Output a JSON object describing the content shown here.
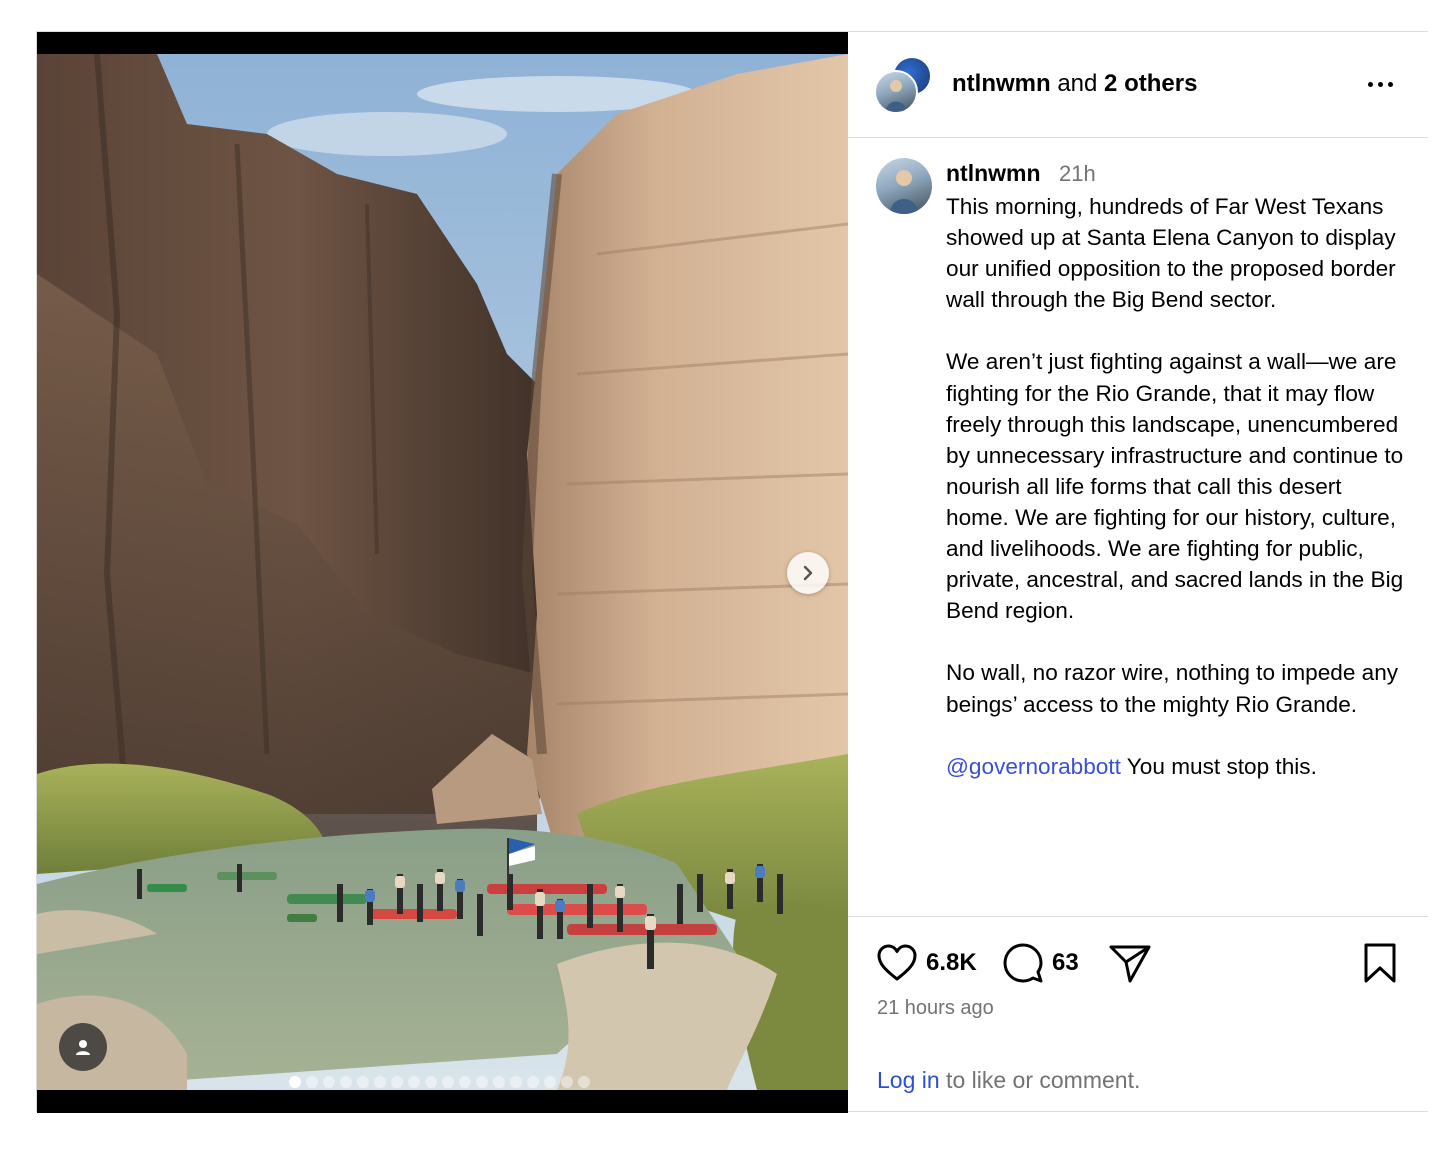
{
  "header": {
    "username": "ntlnwmn",
    "joiner": "and",
    "others": "2 others"
  },
  "caption": {
    "username": "ntlnwmn",
    "time": "21h",
    "paragraphs": [
      "This morning, hundreds of Far West Texans showed up at Santa Elena Canyon to display our unified opposition to the proposed border wall through the Big Bend sector.",
      "We aren’t just fighting against a wall—we are fighting for the Rio Grande, that it may flow freely through this landscape, unencumbered by unnecessary infrastructure and continue to nourish all life forms that call this desert home. We are fighting for our history, culture, and livelihoods. We are fighting for public, private, ancestral, and sacred lands in the Big Bend region.",
      "No wall, no razor wire, nothing to impede any beings’ access to the mighty Rio Grande."
    ],
    "mention": "@governorabbott",
    "last_line": " You must stop this."
  },
  "actions": {
    "likes": "6.8K",
    "comments": "63",
    "time_ago": "21 hours ago",
    "login_link": "Log in",
    "login_rest": " to like or comment."
  },
  "carousel": {
    "total_slides": 18,
    "active_slide": 1
  },
  "icons": {
    "like": "heart-icon",
    "comment": "comment-bubble-icon",
    "share": "paper-plane-icon",
    "save": "bookmark-icon",
    "next": "chevron-right-icon",
    "tags": "person-icon",
    "more": "more-options-icon"
  },
  "colors": {
    "link": "#3850d8",
    "muted": "#737373",
    "border": "#dbdbdb"
  }
}
